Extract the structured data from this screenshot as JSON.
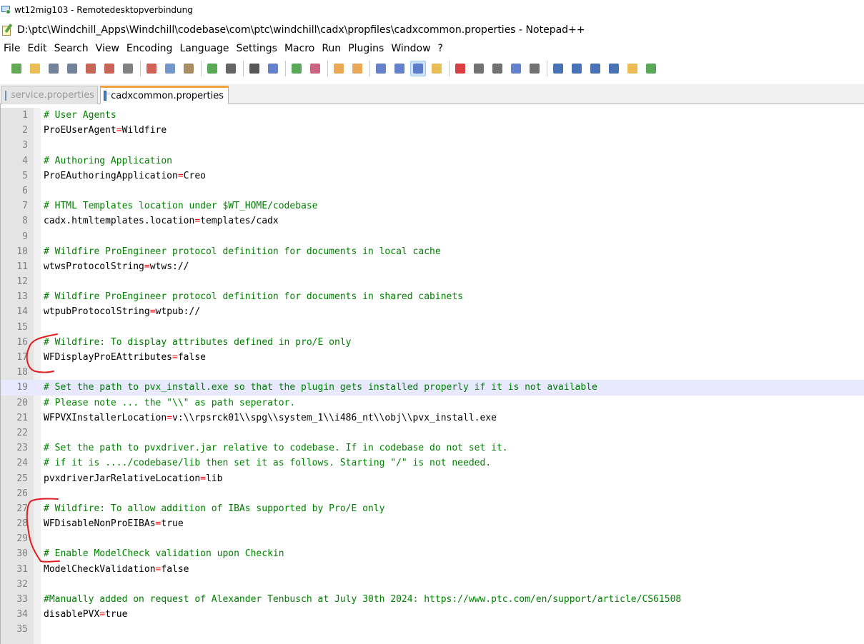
{
  "rdp": {
    "title": "wt12mig103 - Remotedesktopverbindung"
  },
  "window": {
    "title": "D:\\ptc\\Windchill_Apps\\Windchill\\codebase\\com\\ptc\\windchill\\cadx\\propfiles\\cadxcommon.properties - Notepad++"
  },
  "menu": [
    {
      "label": "File"
    },
    {
      "label": "Edit"
    },
    {
      "label": "Search"
    },
    {
      "label": "View"
    },
    {
      "label": "Encoding"
    },
    {
      "label": "Language"
    },
    {
      "label": "Settings"
    },
    {
      "label": "Macro"
    },
    {
      "label": "Run"
    },
    {
      "label": "Plugins"
    },
    {
      "label": "Window"
    },
    {
      "label": "?"
    }
  ],
  "toolbar": {
    "icons": [
      {
        "name": "new-file-icon",
        "color": "#4a9b3a"
      },
      {
        "name": "open-file-icon",
        "color": "#e8b23a"
      },
      {
        "name": "save-icon",
        "color": "#5b6b8c"
      },
      {
        "name": "save-all-icon",
        "color": "#5b6b8c"
      },
      {
        "name": "close-icon",
        "color": "#c04a3a"
      },
      {
        "name": "close-all-icon",
        "color": "#c04a3a"
      },
      {
        "name": "print-icon",
        "color": "#6b6b6b"
      },
      {
        "sep": true
      },
      {
        "name": "cut-icon",
        "color": "#c84a3a"
      },
      {
        "name": "copy-icon",
        "color": "#5a84c4"
      },
      {
        "name": "paste-icon",
        "color": "#9a7a4a"
      },
      {
        "sep": true
      },
      {
        "name": "undo-icon",
        "color": "#3a9a3a"
      },
      {
        "name": "redo-icon",
        "color": "#4a4a4a"
      },
      {
        "sep": true
      },
      {
        "name": "find-icon",
        "color": "#3a3a3a"
      },
      {
        "name": "replace-icon",
        "color": "#4a6ac4"
      },
      {
        "sep": true
      },
      {
        "name": "zoom-in-icon",
        "color": "#3a9a3a"
      },
      {
        "name": "zoom-out-icon",
        "color": "#c04a6a"
      },
      {
        "sep": true
      },
      {
        "name": "sync-vertical-icon",
        "color": "#e89a3a"
      },
      {
        "name": "sync-horizontal-icon",
        "color": "#e89a3a"
      },
      {
        "sep": true
      },
      {
        "name": "word-wrap-icon",
        "color": "#4a6ac4"
      },
      {
        "name": "show-all-chars-icon",
        "color": "#4a6ac4"
      },
      {
        "name": "indent-guide-icon",
        "color": "#4a6ac4",
        "active": true
      },
      {
        "name": "document-map-icon",
        "color": "#e8b23a"
      },
      {
        "sep": true
      },
      {
        "name": "record-macro-icon",
        "color": "#d02020"
      },
      {
        "name": "stop-macro-icon",
        "color": "#5a5a5a"
      },
      {
        "name": "play-macro-icon",
        "color": "#5a5a5a"
      },
      {
        "name": "play-multiple-icon",
        "color": "#4a6ac4"
      },
      {
        "name": "save-macro-icon",
        "color": "#5a5a5a"
      },
      {
        "sep": true
      },
      {
        "name": "fold-all-icon",
        "color": "#2a5aa8"
      },
      {
        "name": "previous-icon",
        "color": "#2a5aa8"
      },
      {
        "name": "next-icon",
        "color": "#2a5aa8"
      },
      {
        "name": "unfold-all-icon",
        "color": "#2a5aa8"
      },
      {
        "name": "launch-browser-icon",
        "color": "#e8b23a"
      },
      {
        "name": "spell-check-icon",
        "color": "#3a9a3a"
      }
    ]
  },
  "tabs": [
    {
      "label": "service.properties",
      "active": false
    },
    {
      "label": "cadxcommon.properties",
      "active": true
    }
  ],
  "editor": {
    "current_line": 19,
    "lines": [
      {
        "n": "1",
        "type": "comment",
        "text": "# User Agents"
      },
      {
        "n": "2",
        "type": "prop",
        "key": "ProEUserAgent",
        "value": "Wildfire"
      },
      {
        "n": "3",
        "type": "empty"
      },
      {
        "n": "4",
        "type": "comment",
        "text": "# Authoring Application"
      },
      {
        "n": "5",
        "type": "prop",
        "key": "ProEAuthoringApplication",
        "value": "Creo"
      },
      {
        "n": "6",
        "type": "empty"
      },
      {
        "n": "7",
        "type": "comment",
        "text": "# HTML Templates location under $WT_HOME/codebase"
      },
      {
        "n": "8",
        "type": "prop",
        "key": "cadx.htmltemplates.location",
        "value": "templates/cadx"
      },
      {
        "n": "9",
        "type": "empty"
      },
      {
        "n": "10",
        "type": "comment",
        "text": "# Wildfire ProEngineer protocol definition for documents in local cache"
      },
      {
        "n": "11",
        "type": "prop",
        "key": "wtwsProtocolString",
        "value": "wtws://"
      },
      {
        "n": "12",
        "type": "empty"
      },
      {
        "n": "13",
        "type": "comment",
        "text": "# Wildfire ProEngineer protocol definition for documents in shared cabinets"
      },
      {
        "n": "14",
        "type": "prop",
        "key": "wtpubProtocolString",
        "value": "wtpub://"
      },
      {
        "n": "15",
        "type": "empty"
      },
      {
        "n": "16",
        "type": "comment",
        "text": "# Wildfire: To display attributes defined in pro/E only"
      },
      {
        "n": "17",
        "type": "prop",
        "key": "WFDisplayProEAttributes",
        "value": "false"
      },
      {
        "n": "18",
        "type": "empty"
      },
      {
        "n": "19",
        "type": "comment",
        "text": "# Set the path to pvx_install.exe so that the plugin gets installed properly if it is not available"
      },
      {
        "n": "20",
        "type": "comment",
        "text": "# Please note ... the \"\\\\\" as path seperator."
      },
      {
        "n": "21",
        "type": "prop",
        "key": "WFPVXInstallerLocation",
        "value": "v:\\\\rpsrck01\\\\spg\\\\system_1\\\\i486_nt\\\\obj\\\\pvx_install.exe"
      },
      {
        "n": "22",
        "type": "empty"
      },
      {
        "n": "23",
        "type": "comment",
        "text": "# Set the path to pvxdriver.jar relative to codebase. If in codebase do not set it."
      },
      {
        "n": "24",
        "type": "comment",
        "text": "# if it is ..../codebase/lib then set it as follows. Starting \"/\" is not needed."
      },
      {
        "n": "25",
        "type": "prop",
        "key": "pvxdriverJarRelativeLocation",
        "value": "lib"
      },
      {
        "n": "26",
        "type": "empty"
      },
      {
        "n": "27",
        "type": "comment",
        "text": "# Wildfire: To allow addition of IBAs supported by Pro/E only"
      },
      {
        "n": "28",
        "type": "prop",
        "key": "WFDisableNonProEIBAs",
        "value": "true"
      },
      {
        "n": "29",
        "type": "empty"
      },
      {
        "n": "30",
        "type": "comment",
        "text": "# Enable ModelCheck validation upon Checkin"
      },
      {
        "n": "31",
        "type": "prop",
        "key": "ModelCheckValidation",
        "value": "false"
      },
      {
        "n": "32",
        "type": "empty"
      },
      {
        "n": "33",
        "type": "comment",
        "text": "#Manually added on request of Alexander Tenbusch at July 30th 2024: https://www.ptc.com/en/support/article/CS61508"
      },
      {
        "n": "34",
        "type": "prop",
        "key": "disablePVX",
        "value": "true"
      },
      {
        "n": "35",
        "type": "empty"
      }
    ]
  },
  "annotation": {
    "color": "#e02020"
  }
}
